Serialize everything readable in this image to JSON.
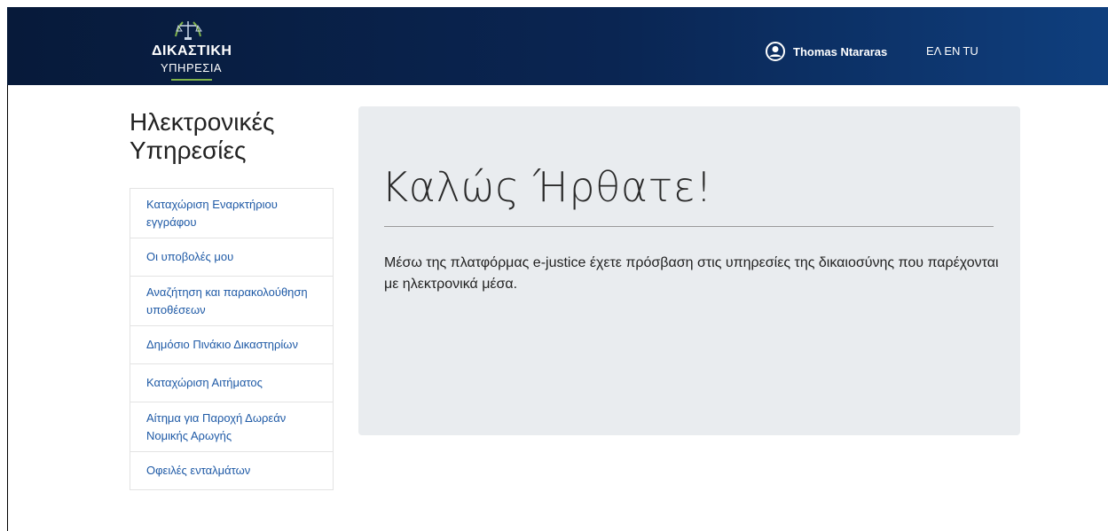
{
  "header": {
    "logo_title": "ΔΙΚΑΣΤΙΚΗ",
    "logo_subtitle": "ΥΠΗΡΕΣΙΑ",
    "user_name": "Thomas Ntararas",
    "languages": [
      "ΕΛ",
      "EN",
      "TU"
    ],
    "colors": {
      "bar": "#0a2552",
      "accent": "#7fb24a"
    }
  },
  "sidebar": {
    "title": "Ηλεκτρονικές Υπηρεσίες",
    "items": [
      {
        "label": "Καταχώριση Εναρκτήριου εγγράφου"
      },
      {
        "label": "Οι υποβολές μου"
      },
      {
        "label": "Αναζήτηση και παρακολούθηση υποθέσεων"
      },
      {
        "label": "Δημόσιο Πινάκιο Δικαστηρίων"
      },
      {
        "label": "Καταχώριση Αιτήματος"
      },
      {
        "label": "Αίτημα για Παροχή Δωρεάν Νομικής Αρωγής"
      },
      {
        "label": "Οφειλές ενταλμάτων"
      }
    ],
    "link_color": "#1f5aa6"
  },
  "main": {
    "heading": "Καλώς Ήρθατε!",
    "lead": "Μέσω της πλατφόρμας e-justice έχετε πρόσβαση στις υπηρεσίες της δικαιοσύνης που παρέχονται με ηλεκτρονικά μέσα."
  }
}
